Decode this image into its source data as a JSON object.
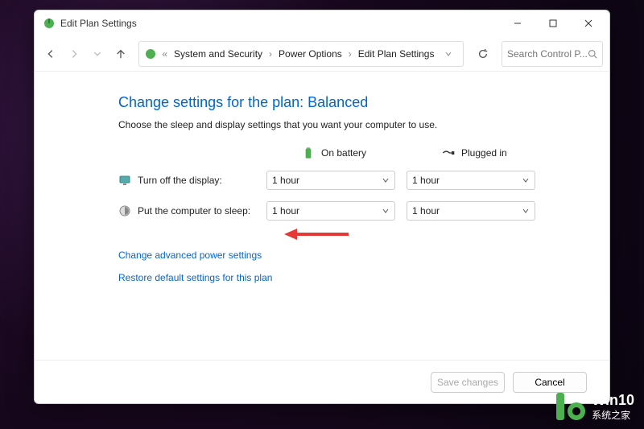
{
  "window": {
    "title": "Edit Plan Settings"
  },
  "breadcrumb": {
    "items": [
      "System and Security",
      "Power Options",
      "Edit Plan Settings"
    ]
  },
  "search": {
    "placeholder": "Search Control P..."
  },
  "page": {
    "heading": "Change settings for the plan: Balanced",
    "subtext": "Choose the sleep and display settings that you want your computer to use."
  },
  "columns": {
    "battery": "On battery",
    "plugged": "Plugged in"
  },
  "rows": {
    "display": {
      "label": "Turn off the display:",
      "battery": "1 hour",
      "plugged": "1 hour"
    },
    "sleep": {
      "label": "Put the computer to sleep:",
      "battery": "1 hour",
      "plugged": "1 hour"
    }
  },
  "links": {
    "advanced": "Change advanced power settings",
    "restore": "Restore default settings for this plan"
  },
  "footer": {
    "save": "Save changes",
    "cancel": "Cancel"
  },
  "watermark": {
    "line1": "Win10",
    "line2": "系统之家"
  }
}
